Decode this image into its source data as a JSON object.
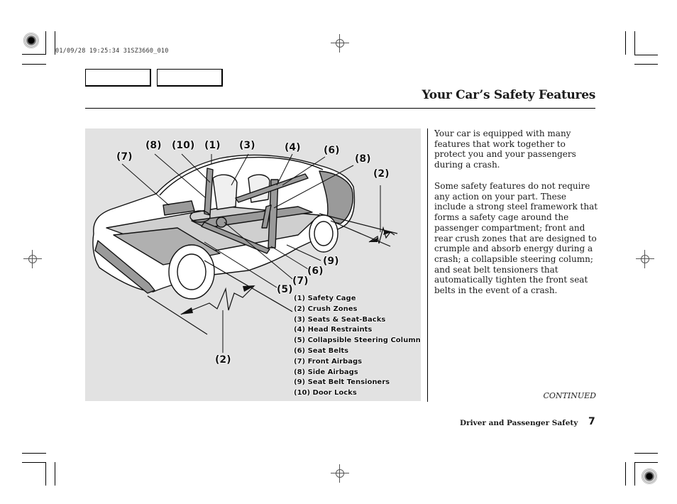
{
  "print_stamp": "01/09/28 19:25:34 31SZ3660_010",
  "header": {
    "title": "Your Car’s Safety Features"
  },
  "figure": {
    "callouts": {
      "c7": "(7)",
      "c8_top": "(8)",
      "c10": "(10)",
      "c1": "(1)",
      "c3": "(3)",
      "c4": "(4)",
      "c6_top": "(6)",
      "c8_right": "(8)",
      "c2_right": "(2)",
      "c9": "(9)",
      "c6_bottom": "(6)",
      "c7_bottom": "(7)",
      "c5": "(5)",
      "c2_bottom": "(2)"
    },
    "legend": [
      "(1) Safety Cage",
      "(2) Crush Zones",
      "(3) Seats & Seat-Backs",
      "(4) Head Restraints",
      "(5) Collapsible Steering Column",
      "(6) Seat Belts",
      "(7) Front Airbags",
      "(8) Side Airbags",
      "(9) Seat Belt Tensioners",
      "(10) Door Locks"
    ]
  },
  "body": {
    "paragraphs": [
      "Your car is equipped with many features that work together to protect you and your passengers during a crash.",
      "Some safety features do not require any action on your part. These include a strong steel framework that forms a safety cage around the passenger compartment; front and rear crush zones that are designed to crumple and absorb energy during a crash; a collapsible steering column; and seat belt tensioners that automatically tighten the front seat belts in the event of a crash."
    ],
    "continued": "CONTINUED"
  },
  "footer": {
    "section": "Driver and Passenger Safety",
    "page_number": "7"
  },
  "colors": {
    "figure_bg": "#e2e2e2",
    "frame_gray": "#9a9a9a",
    "text": "#1a1a1a"
  }
}
